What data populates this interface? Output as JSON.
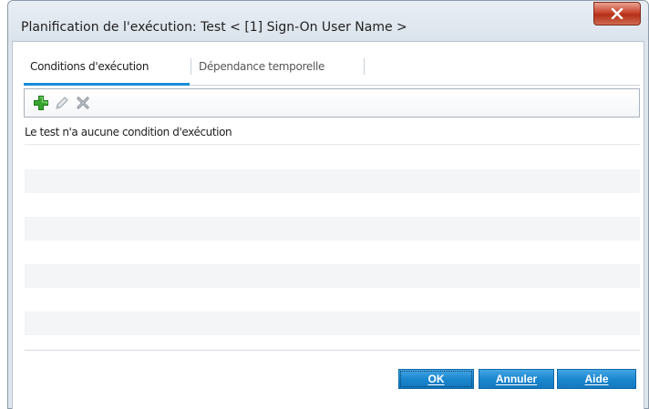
{
  "window": {
    "title": "Planification de l'exécution: Test < [1] Sign-On User Name >",
    "close_icon": "close-x-icon"
  },
  "tabs": [
    {
      "label": "Conditions d'exécution",
      "active": true
    },
    {
      "label": "Dépendance temporelle",
      "active": false
    }
  ],
  "toolbar": {
    "add_icon": "green-plus-icon",
    "edit_icon": "pencil-icon",
    "delete_icon": "gray-x-icon"
  },
  "main": {
    "empty_message": "Le test n'a aucune condition d'exécution"
  },
  "buttons": {
    "ok": "OK",
    "cancel": "Annuler",
    "help": "Aide"
  },
  "colors": {
    "accent": "#1a8dd8",
    "button": "#1b87cf",
    "close": "#c9452d",
    "add": "#3aa531"
  }
}
